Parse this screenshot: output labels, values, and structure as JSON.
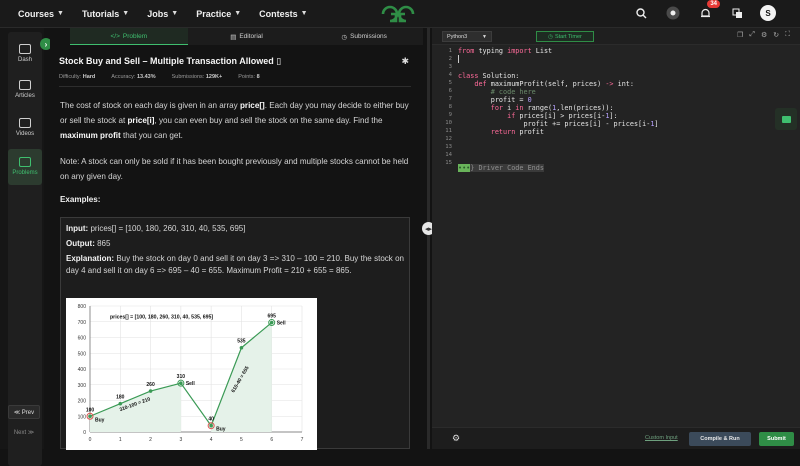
{
  "nav": {
    "items": [
      {
        "label": "Courses"
      },
      {
        "label": "Tutorials"
      },
      {
        "label": "Jobs"
      },
      {
        "label": "Practice"
      },
      {
        "label": "Contests"
      }
    ],
    "notification_count": "34",
    "avatar_letter": "S"
  },
  "sidebar": {
    "items": [
      {
        "label": "Dash"
      },
      {
        "label": "Articles"
      },
      {
        "label": "Videos"
      },
      {
        "label": "Problems"
      }
    ],
    "prev_label": "≪ Prev",
    "next_label": "Next ≫"
  },
  "tabs": [
    {
      "label": "Problem"
    },
    {
      "label": "Editorial"
    },
    {
      "label": "Submissions"
    }
  ],
  "problem": {
    "title": "Stock Buy and Sell – Multiple Transaction Allowed",
    "difficulty_label": "Difficulty:",
    "difficulty_value": "Hard",
    "accuracy_label": "Accuracy:",
    "accuracy_value": "13.43%",
    "submissions_label": "Submissions:",
    "submissions_value": "129K+",
    "points_label": "Points:",
    "points_value": "8",
    "para1_a": "The cost of stock on each day is given in an array ",
    "para1_b": "price[]",
    "para1_c": ". Each day you may decide to either buy or sell the stock at ",
    "para1_d": "price[i]",
    "para1_e": ", you can even buy and sell the stock on the same day. Find the ",
    "para1_f": "maximum profit",
    "para1_g": " that you can get.",
    "para2": "Note: A stock can only be sold if it has been bought previously and multiple stocks cannot be held on any given day.",
    "examples_label": "Examples:",
    "input_label": "Input:",
    "input_value": " prices[] = [100, 180, 260, 310, 40, 535, 695]",
    "output_label": "Output:",
    "output_value": " 865",
    "explanation_label": "Explanation:",
    "explanation_value": " Buy the stock on day 0 and sell it on day 3 => 310 – 100 = 210. Buy the stock on day 4 and sell it on day 6 => 695 – 40 = 655. Maximum Profit = 210 + 655 = 865."
  },
  "chart_data": {
    "type": "line",
    "title": "prices[] = [100, 180, 260, 310, 40, 535, 695]",
    "x": [
      0,
      1,
      2,
      3,
      4,
      5,
      6
    ],
    "values": [
      100,
      180,
      260,
      310,
      40,
      535,
      695
    ],
    "point_labels": [
      "100",
      "180",
      "260",
      "310",
      "40",
      "535",
      "695"
    ],
    "annotations": [
      {
        "text": "Buy",
        "at": 0
      },
      {
        "text": "Sell",
        "at": 3
      },
      {
        "text": "Buy",
        "at": 4
      },
      {
        "text": "Sell",
        "at": 6
      },
      {
        "text": "310-100 = 210",
        "segment": [
          0,
          3
        ]
      },
      {
        "text": "610-40 = 655",
        "segment": [
          4,
          6
        ]
      }
    ],
    "xlim": [
      0,
      7
    ],
    "ylim": [
      0,
      800
    ],
    "xticks": [
      0,
      1,
      2,
      3,
      4,
      5,
      6,
      7
    ],
    "yticks": [
      0,
      100,
      200,
      300,
      400,
      500,
      600,
      700,
      800
    ],
    "grid": true
  },
  "editor": {
    "language": "Python3",
    "timer_label": "Start Timer",
    "custom_input_label": "Custom Input",
    "compile_label": "Compile & Run",
    "submit_label": "Submit",
    "line_numbers": [
      "1",
      "2",
      "3",
      "4",
      "5",
      "6",
      "7",
      "8",
      "9",
      "10",
      "11",
      "12",
      "13",
      "14",
      "15"
    ],
    "code": {
      "l1_a": "from",
      "l1_b": " typing ",
      "l1_c": "import",
      "l1_d": " List",
      "l4_a": "class",
      "l4_b": " Solution:",
      "l5_a": "    def",
      "l5_b": " maximumProfit(self, prices) ",
      "l5_c": "->",
      "l5_d": " int:",
      "l6": "        # code here",
      "l7_a": "        profit = ",
      "l7_b": "0",
      "l8_a": "        for",
      "l8_b": " i ",
      "l8_c": "in",
      "l8_d": " range(",
      "l8_e": "1",
      "l8_f": ",len(prices)):",
      "l9_a": "            if",
      "l9_b": " prices[i] > prices[i-",
      "l9_c": "1",
      "l9_d": "]:",
      "l10_a": "                profit += prices[i] - prices[i-",
      "l10_b": "1",
      "l10_c": "]",
      "l11_a": "        return",
      "l11_b": " profit",
      "l15_a": "•••",
      "l15_b": "} Driver Code Ends"
    }
  },
  "colors": {
    "accent_green": "#2f8d46",
    "bg": "#131313",
    "chart_line": "#3a9a55",
    "chart_fill": "#e5f2e9"
  }
}
